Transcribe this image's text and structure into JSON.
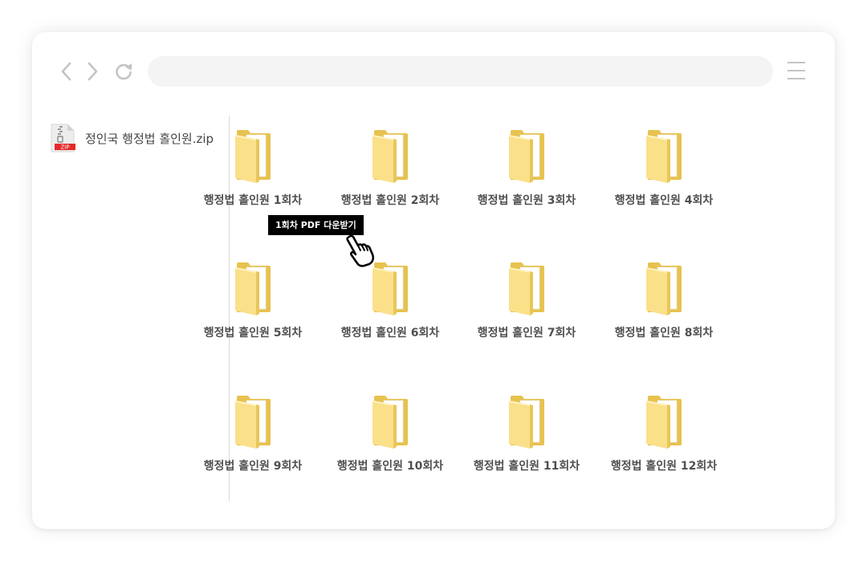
{
  "browser": {
    "address_value": "",
    "icons": {
      "back": "chevron-left-icon",
      "forward": "chevron-right-icon",
      "reload": "reload-icon",
      "menu": "hamburger-menu-icon"
    }
  },
  "sidebar": {
    "file_name": "정인국 행정법 홀인원.zip",
    "file_badge": "ZIP",
    "file_icon": "zip-file-icon"
  },
  "folders": [
    "행정법 홀인원 1회차",
    "행정법 홀인원 2회차",
    "행정법 홀인원 3회차",
    "행정법 홀인원 4회차",
    "행정법 홀인원 5회차",
    "행정법 홀인원 6회차",
    "행정법 홀인원 7회차",
    "행정법 홀인원 8회차",
    "행정법 홀인원 9회차",
    "행정법 홀인원 10회차",
    "행정법 홀인원 11회차",
    "행정법 홀인원 12회차"
  ],
  "tooltip": {
    "label": "1회차 PDF 다운받기"
  },
  "cursor": {
    "icon": "hand-pointer-icon"
  },
  "colors": {
    "folder_back": "#e7c24f",
    "folder_front": "#fbe08a",
    "zip_badge": "#e52a2a",
    "tooltip_bg": "#000000"
  }
}
